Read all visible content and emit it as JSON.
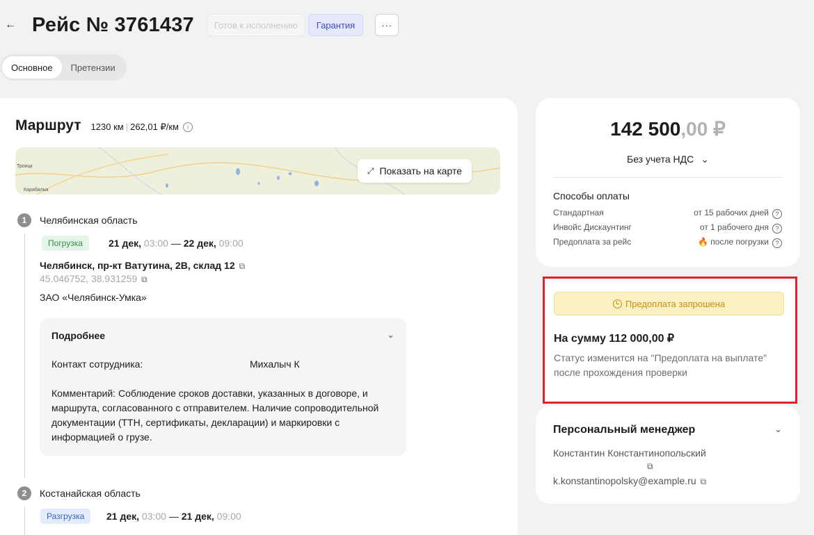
{
  "header": {
    "back_icon": "←",
    "title": "Рейс № 3761437",
    "status_badge": "Готов к исполнению",
    "guarantee_badge": "Гарантия",
    "more_icon": "···"
  },
  "tabs": [
    {
      "label": "Основное",
      "active": true
    },
    {
      "label": "Претензии",
      "active": false
    }
  ],
  "route": {
    "title": "Маршрут",
    "distance": "1230 км",
    "rate": "262,01 ₽/км",
    "info_icon": "i",
    "map": {
      "show_button": "Показать на карте",
      "expand_icon": "⤢",
      "label_troitsk": "Троицк",
      "label_karabalyk": "Карабалык"
    },
    "stops": [
      {
        "num": "1",
        "region": "Челябинская область",
        "tag": "Погрузка",
        "date_from": "21 дек,",
        "time_from": "03:00",
        "dash": "—",
        "date_to": "22 дек,",
        "time_to": "09:00",
        "address": "Челябинск, пр-кт Ватутина, 2В, склад 12",
        "coords": "45.046752, 38.931259",
        "company": "ЗАО «Челябинск-Умка»"
      },
      {
        "num": "2",
        "region": "Костанайская область",
        "tag": "Разгрузка",
        "date_from": "21 дек,",
        "time_from": "03:00",
        "dash": "—",
        "date_to": "21 дек,",
        "time_to": "09:00"
      }
    ],
    "details": {
      "title": "Подробнее",
      "contact_label": "Контакт сотрудника:",
      "contact_value": "Михалыч К",
      "comment": "Комментарий: Соблюдение сроков доставки, указанных в договоре, и маршрута, согласованного с отправителем. Наличие сопроводительной документации (ТТН, сертификаты, декларации) и маркировки с информацией о грузе."
    },
    "copy_icon": "⧉"
  },
  "price_card": {
    "amount_main": "142 500",
    "amount_frac": ",00 ₽",
    "vat": "Без учета НДС",
    "vat_chevron": "⌄",
    "payment_title": "Способы оплаты",
    "payment_methods": [
      {
        "name": "Стандартная",
        "term": "от 15 рабочих дней"
      },
      {
        "name": "Инвойс Дискаунтинг",
        "term": "от 1 рабочего дня"
      },
      {
        "name": "Предоплата за рейс",
        "term": "после погрузки",
        "fire": "🔥"
      }
    ],
    "help_icon": "?"
  },
  "prepayment": {
    "status": "Предоплата запрошена",
    "sum": "На сумму 112 000,00 ₽",
    "note": "Статус изменится на \"Предоплата на выплате\" после прохождения проверки"
  },
  "manager": {
    "title": "Персональный менеджер",
    "name": "Константин Константинопольский",
    "email": "k.konstantinopolsky@example.ru",
    "chevron": "⌄"
  },
  "colors": {
    "accent_blue": "#3b4cc7",
    "highlight_red": "#e0212b",
    "warning_yellow": "#fbf0c2",
    "success_green": "#3a8a4c"
  }
}
